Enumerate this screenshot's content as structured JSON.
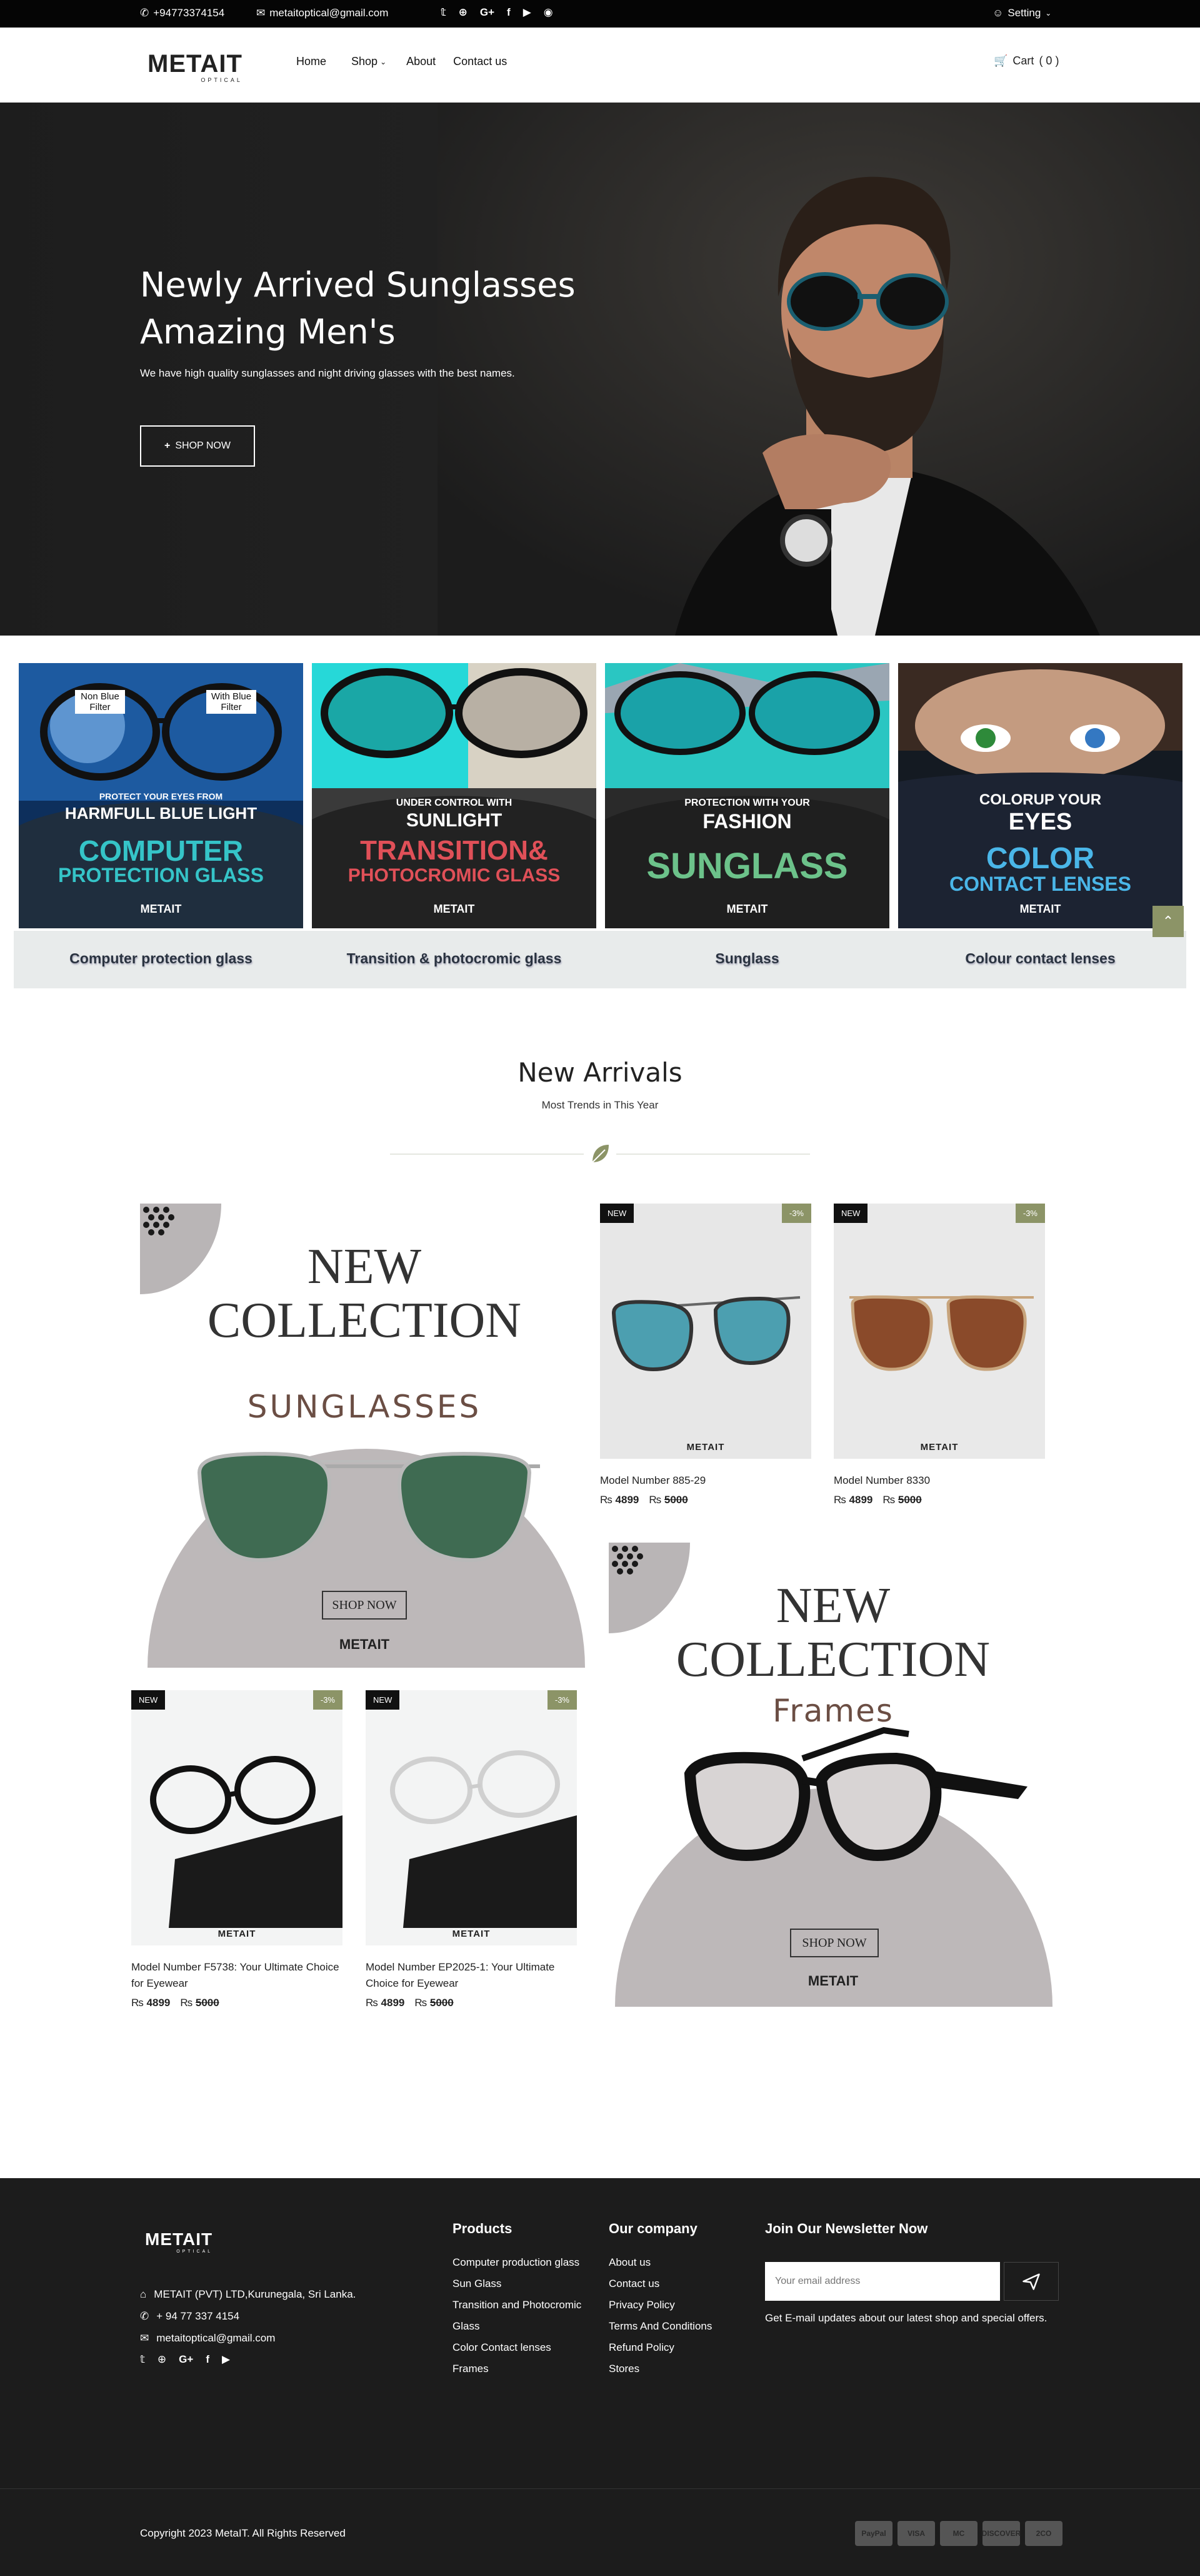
{
  "topbar": {
    "phone": "+94773374154",
    "email": "metaitoptical@gmail.com",
    "social": [
      "twitter-icon",
      "rss-icon",
      "google-plus-icon",
      "facebook-icon",
      "youtube-icon",
      "instagram-icon"
    ],
    "setting_label": "Setting"
  },
  "header": {
    "logo_main": "METAIT",
    "logo_sub": "OPTICAL",
    "nav": [
      "Home",
      "Shop",
      "About",
      "Contact us"
    ],
    "cart_label": "Cart",
    "cart_count": "( 0 )"
  },
  "hero": {
    "title_line1": "Newly Arrived Sunglasses",
    "title_line2": "Amazing Men's",
    "description": "We have high quality sunglasses and night driving glasses with the best names.",
    "button": "SHOP NOW"
  },
  "categories": [
    {
      "label": "Computer protection glass",
      "img_top1": "Non Blue Filter",
      "img_top2": "With Blue Filter",
      "img_small": "PROTECT YOUR EYES FROM",
      "img_mid": "HARMFULL BLUE LIGHT",
      "img_big1": "COMPUTER",
      "img_big2": "PROTECTION GLASS",
      "color1": "#35c4c8",
      "color2": "#35c4c8"
    },
    {
      "label": "Transition & photocromic glass",
      "img_small": "UNDER CONTROL WITH",
      "img_mid": "SUNLIGHT",
      "img_big1": "TRANSITION&",
      "img_big2": "PHOTOCROMIC GLASS",
      "color1": "#e05058",
      "color2": "#e05058"
    },
    {
      "label": "Sunglass",
      "img_small": "PROTECTION WITH YOUR",
      "img_mid": "FASHION",
      "img_big1": "SUNGLASS",
      "img_big2": "",
      "color1": "#6cc28a",
      "color2": "#6cc28a"
    },
    {
      "label": "Colour contact lenses",
      "img_small": "COLORUP YOUR",
      "img_mid": "EYES",
      "img_big1": "COLOR",
      "img_big2": "CONTACT LENSES",
      "color1": "#4ab6e8",
      "color2": "#4ab6e8"
    }
  ],
  "new_arrivals": {
    "title": "New Arrivals",
    "subtitle": "Most Trends in This Year"
  },
  "banners": [
    {
      "line1": "NEW",
      "line2": "COLLECTION",
      "line3": "SUNGLASSES",
      "button": "SHOP NOW",
      "logo": "METAIT"
    },
    {
      "line1": "NEW",
      "line2": "COLLECTION",
      "line3": "Frames",
      "button": "SHOP NOW",
      "logo": "METAIT"
    }
  ],
  "products": [
    {
      "badge": "NEW",
      "discount": "-3%",
      "name": "Model Number 885-29",
      "price": "4899",
      "old_price": "5000",
      "logo": "METAIT"
    },
    {
      "badge": "NEW",
      "discount": "-3%",
      "name": "Model Number 8330",
      "price": "4899",
      "old_price": "5000",
      "logo": "METAIT"
    },
    {
      "badge": "NEW",
      "discount": "-3%",
      "name": "Model Number F5738: Your Ultimate Choice for Eyewear",
      "price": "4899",
      "old_price": "5000",
      "logo": "METAIT"
    },
    {
      "badge": "NEW",
      "discount": "-3%",
      "name": "Model Number EP2025-1: Your Ultimate Choice for Eyewear",
      "price": "4899",
      "old_price": "5000",
      "logo": "METAIT"
    }
  ],
  "currency_icon": "rupee-icon",
  "footer": {
    "logo_main": "METAIT",
    "logo_sub": "OPTICAL",
    "address": "METAIT (PVT) LTD,Kurunegala, Sri Lanka.",
    "phone": "+ 94 77 337 4154",
    "email": "metaitoptical@gmail.com",
    "products_title": "Products",
    "products": [
      "Computer production glass",
      "Sun Glass",
      "Transition and Photocromic Glass",
      "Color Contact lenses",
      "Frames"
    ],
    "company_title": "Our company",
    "company": [
      "About us",
      "Contact us",
      "Privacy Policy",
      "Terms And Conditions",
      "Refund Policy",
      "Stores"
    ],
    "newsletter_title": "Join Our Newsletter Now",
    "newsletter_placeholder": "Your email address",
    "newsletter_text": "Get E-mail updates about our latest shop and special offers.",
    "copyright": "Copyright 2023 MetaIT. All Rights Reserved",
    "payments": [
      "PayPal",
      "VISA",
      "MC",
      "DISCOVER",
      "2CO"
    ]
  }
}
